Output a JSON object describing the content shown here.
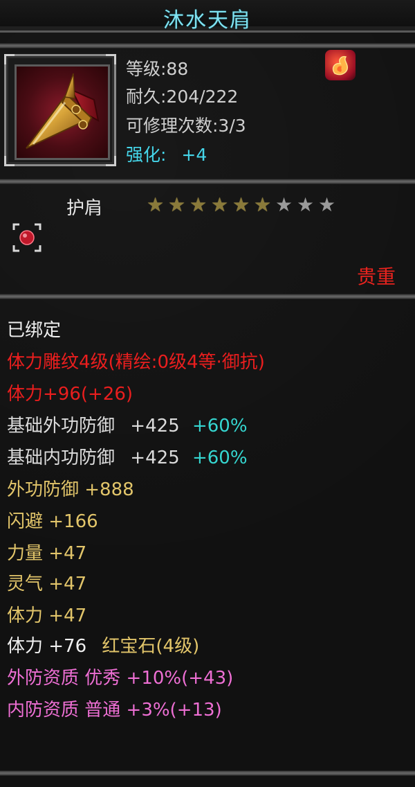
{
  "title": "沐水天肩",
  "item": {
    "level_text": "等级:88",
    "durability_text": "耐久:204/222",
    "repair_text": "可修理次数:3/3",
    "enhance_label": "强化:",
    "enhance_value": "+4",
    "slot_name": "护肩",
    "stars_total": 9,
    "stars_filled": 6,
    "rarity": "贵重"
  },
  "stats": {
    "bound": "已绑定",
    "carving": "体力雕纹4级(精绘:0级4等·御抗)",
    "stamina_bonus": "体力+96(+26)",
    "base_outer_def_label": "基础外功防御",
    "base_outer_def_value": "+425",
    "base_outer_def_pct": "+60%",
    "base_inner_def_label": "基础内功防御",
    "base_inner_def_value": "+425",
    "base_inner_def_pct": "+60%",
    "outer_def": "外功防御  +888",
    "dodge": "闪避  +166",
    "strength": "力量  +47",
    "spirit": "灵气  +47",
    "stamina": "体力  +47",
    "gem_stat": "体力 +76",
    "gem_name": "红宝石(4级)",
    "outer_quality": "外防资质  优秀 +10%(+43)",
    "inner_quality": "内防资质  普通 +3%(+13)"
  },
  "colors": {
    "title": "#7fe3f2",
    "enhance": "#45d6ea",
    "rarity": "#e8231e",
    "red_stat": "#ea1e1e",
    "yellow_stat": "#e2c56a",
    "pink_stat": "#ee6fd4",
    "teal_pct": "#35d6d0"
  },
  "icons": {
    "item_icon": "golden-shoulder-pad-icon",
    "badge_icon": "flame-emblem-icon",
    "socket_icon": "red-gem-socket-icon",
    "star_icon": "star-icon"
  }
}
